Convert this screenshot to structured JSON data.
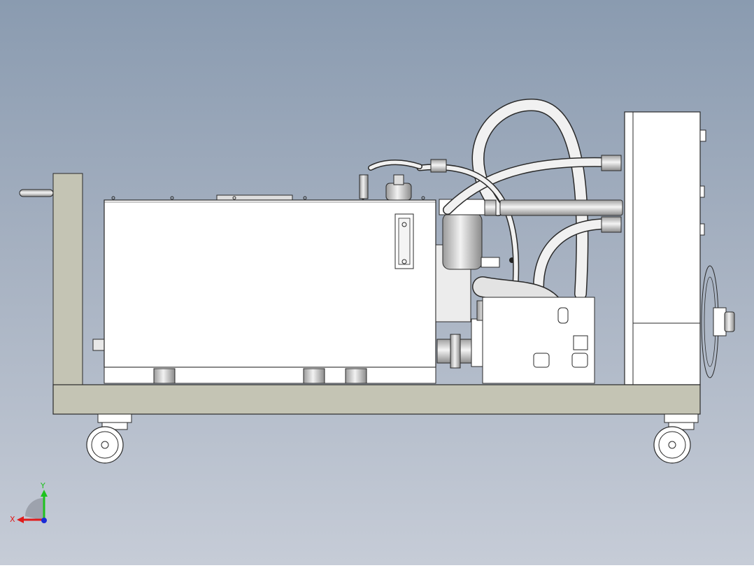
{
  "scene": {
    "background_top": "#8a9bb0",
    "background_bottom": "#c6ccd7",
    "frame_color": "#c4c4b4",
    "part_fill": "#ffffff",
    "outline_color": "#2a2a2a"
  },
  "triad": {
    "x_label": "X",
    "y_label": "Y",
    "x_color": "#e01b1b",
    "y_color": "#1ec21e",
    "z_color": "#1b2bd6"
  }
}
